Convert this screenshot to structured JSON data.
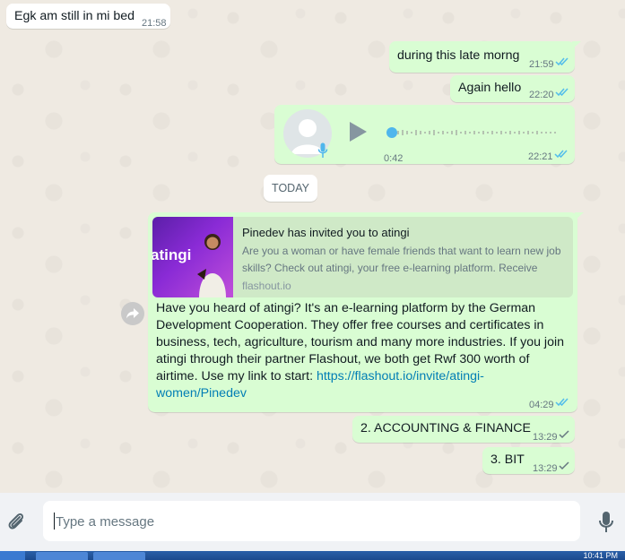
{
  "messages": {
    "m1": {
      "text": "Egk am still in mi bed",
      "time": "21:58"
    },
    "m2": {
      "text": "during this late morng",
      "time": "21:59"
    },
    "m3": {
      "text": "Again hello",
      "time": "22:20"
    },
    "voice": {
      "duration": "0:42",
      "time": "22:21",
      "progress": 0.0
    },
    "date_divider": "TODAY",
    "m5": {
      "preview_title": "Pinedev has invited you to atingi",
      "preview_description": "Are you a woman or have female friends that want to learn new job skills? Check out atingi, your free e-learning platform. Receive",
      "preview_domain": "flashout.io",
      "preview_brand": "atingi",
      "body_text": "Have you heard of atingi? It's an e-learning platform by the German Development Cooperation. They offer free courses and certificates in business, tech, agriculture, tourism and many more industries. If you join atingi through their partner Flashout, we both get Rwf 300 worth of airtime. Use my link to start: ",
      "link": "https://flashout.io/invite/atingi-women/Pinedev",
      "time": "04:29"
    },
    "m6": {
      "text": "2. ACCOUNTING & FINANCE",
      "time": "13:29"
    },
    "m7": {
      "text": "3. BIT",
      "time": "13:29"
    }
  },
  "composer": {
    "placeholder": "Type a message"
  },
  "taskbar": {
    "clock": "10:41 PM"
  },
  "colors": {
    "outgoing_bubble": "#d9fdd3",
    "incoming_bubble": "#ffffff",
    "read_ticks": "#53bdeb",
    "delivered_ticks": "#667781",
    "chat_background": "#efeae2"
  },
  "icons": {
    "read": "double-check-icon",
    "delivered": "single-check-icon",
    "attach": "paperclip-icon",
    "mic": "microphone-icon",
    "play": "play-icon",
    "forward": "forward-icon",
    "avatar": "avatar-icon"
  }
}
